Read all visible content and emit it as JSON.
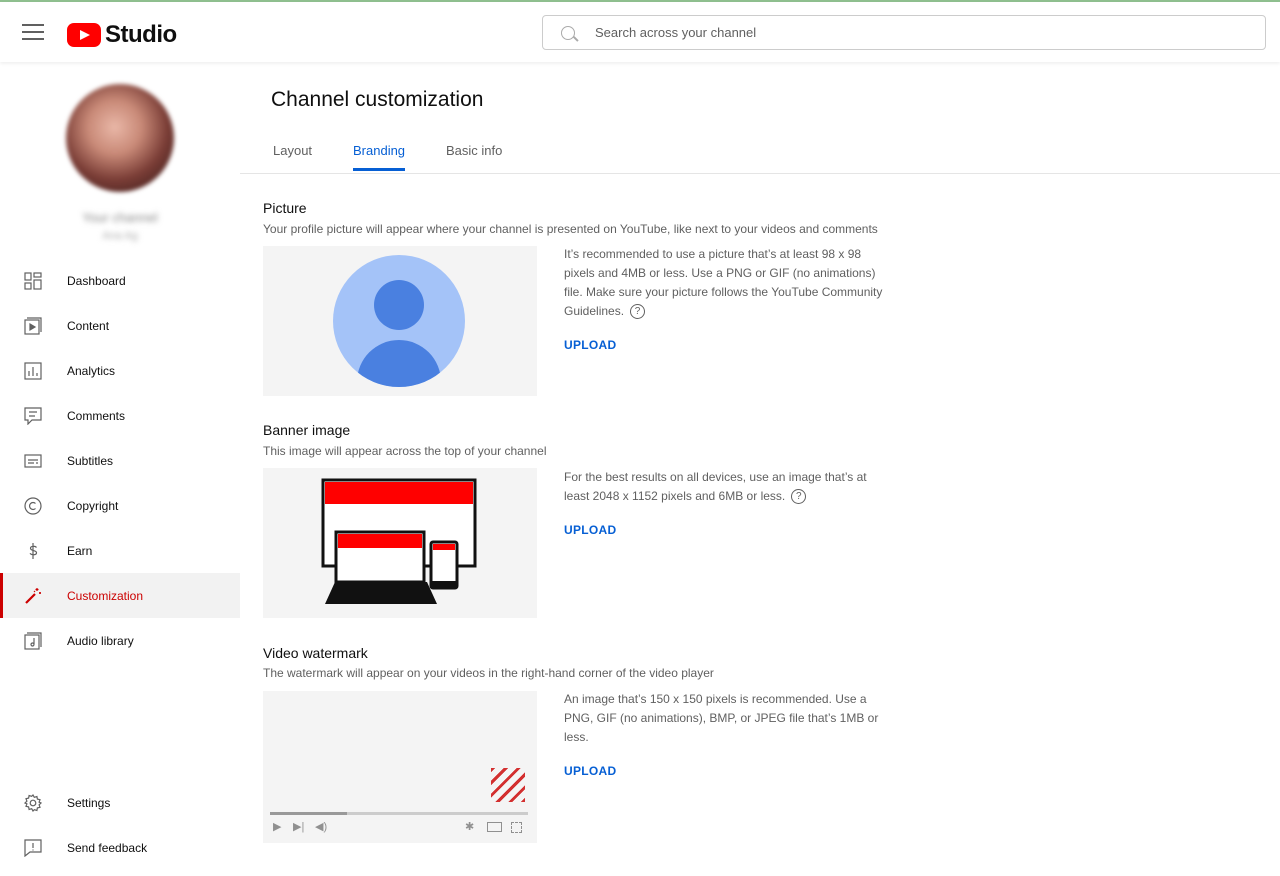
{
  "app": {
    "logo_text": "Studio",
    "brand_color": "#ff0000",
    "accent_color": "#065fd4",
    "active_color": "#cc0000"
  },
  "search": {
    "placeholder": "Search across your channel"
  },
  "sidebar": {
    "channel_name": "Your channel",
    "channel_sub": "Ana Ag",
    "items": [
      {
        "label": "Dashboard",
        "icon": "dashboard-icon",
        "active": false
      },
      {
        "label": "Content",
        "icon": "content-icon",
        "active": false
      },
      {
        "label": "Analytics",
        "icon": "analytics-icon",
        "active": false
      },
      {
        "label": "Comments",
        "icon": "comments-icon",
        "active": false
      },
      {
        "label": "Subtitles",
        "icon": "subtitles-icon",
        "active": false
      },
      {
        "label": "Copyright",
        "icon": "copyright-icon",
        "active": false
      },
      {
        "label": "Earn",
        "icon": "dollar-icon",
        "active": false
      },
      {
        "label": "Customization",
        "icon": "magic-wand-icon",
        "active": true
      },
      {
        "label": "Audio library",
        "icon": "audio-library-icon",
        "active": false
      }
    ],
    "bottom_items": [
      {
        "label": "Settings",
        "icon": "gear-icon"
      },
      {
        "label": "Send feedback",
        "icon": "feedback-icon"
      }
    ]
  },
  "main": {
    "title": "Channel customization",
    "tabs": [
      {
        "label": "Layout",
        "active": false
      },
      {
        "label": "Branding",
        "active": true
      },
      {
        "label": "Basic info",
        "active": false
      }
    ],
    "sections": {
      "picture": {
        "title": "Picture",
        "description": "Your profile picture will appear where your channel is presented on YouTube, like next to your videos and comments",
        "info": "It’s recommended to use a picture that’s at least 98 x 98 pixels and 4MB or less. Use a PNG or GIF (no animations) file. Make sure your picture follows the YouTube Community Guidelines.",
        "upload_label": "UPLOAD"
      },
      "banner": {
        "title": "Banner image",
        "description": "This image will appear across the top of your channel",
        "info": "For the best results on all devices, use an image that’s at least 2048 x 1152 pixels and 6MB or less.",
        "upload_label": "UPLOAD"
      },
      "watermark": {
        "title": "Video watermark",
        "description": "The watermark will appear on your videos in the right-hand corner of the video player",
        "info": "An image that’s 150 x 150 pixels is recommended. Use a PNG, GIF (no animations), BMP, or JPEG file that’s 1MB or less.",
        "upload_label": "UPLOAD"
      }
    }
  }
}
